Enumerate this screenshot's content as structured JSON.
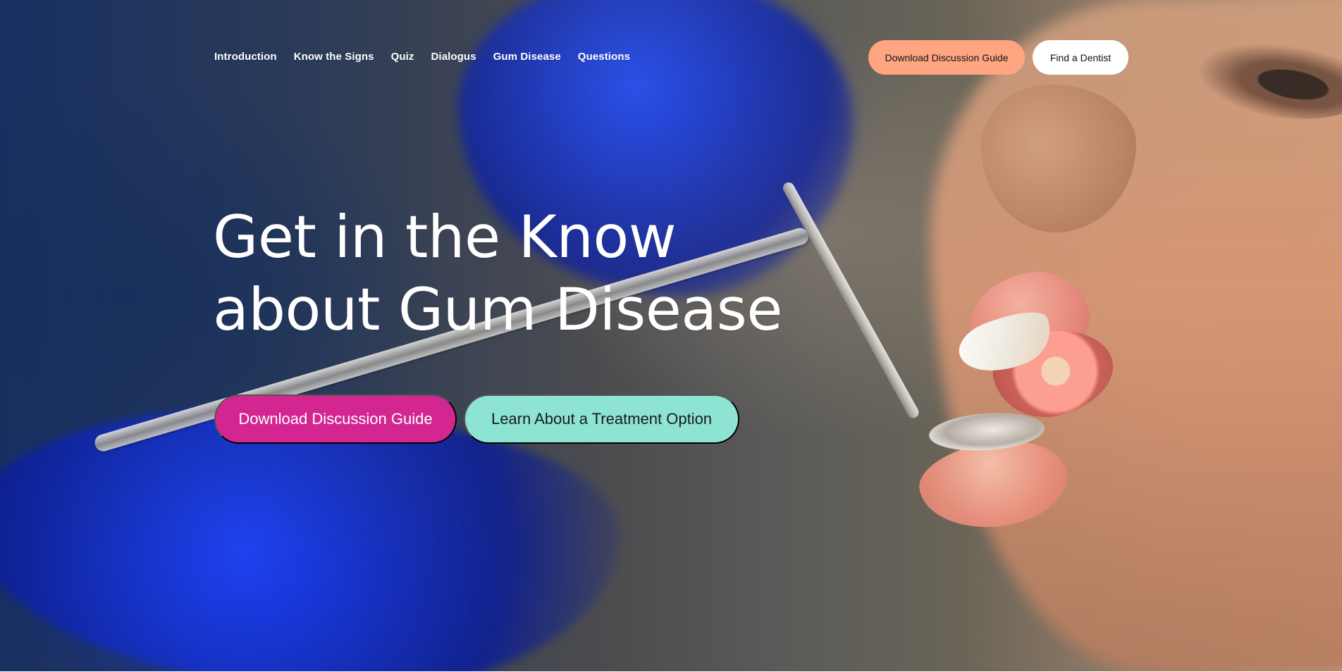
{
  "header": {
    "nav": [
      "Introduction",
      "Know the Signs",
      "Quiz",
      "Dialogus",
      "Gum Disease",
      "Questions"
    ],
    "actions": {
      "download_label": "Download Discussion Guide",
      "find_label": "Find a Dentist"
    }
  },
  "hero": {
    "title_line_1": "Get in the Know",
    "title_line_2": "about Gum Disease",
    "primary_button": "Download Discussion Guide",
    "secondary_button": "Learn About a Treatment Option"
  },
  "colors": {
    "accent_orange": "#ffa582",
    "accent_magenta": "#d32691",
    "accent_mint": "#8de4d3",
    "text_white": "#ffffff"
  }
}
